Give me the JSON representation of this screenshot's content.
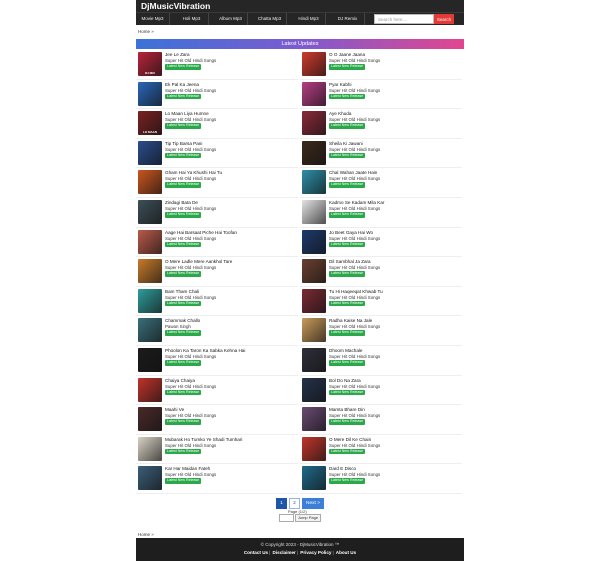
{
  "site": {
    "title": "DjMusicVibration"
  },
  "nav": {
    "items": [
      "Movie Mp3",
      "Holi Mp3",
      "Album Mp3",
      "Chatta Mp3",
      "Hindi Mp3",
      "DJ Remix"
    ],
    "search_placeholder": "Search here....",
    "search_button": "Search"
  },
  "breadcrumb": "Home »",
  "breadcrumb_bottom": "Home »",
  "section_title": "Latest Updates",
  "items": [
    {
      "title": "Jee Le Zara",
      "artist": "Super Hit Old Hindi Songs",
      "badge": "Latest New Release",
      "color": "#b8243a",
      "thumb_text": "DJ MIX"
    },
    {
      "title": "O O Jaane Jaana",
      "artist": "Super Hit Old Hindi Songs",
      "badge": "Latest New Release",
      "color": "#cf3a2e",
      "thumb_text": ""
    },
    {
      "title": "Ek Pal Ka Jeena",
      "artist": "Super Hit Old Hindi Songs",
      "badge": "Latest New Release",
      "color": "#2a67b8",
      "thumb_text": ""
    },
    {
      "title": "Pyar Kabhi",
      "artist": "Super Hit Old Hindi Songs",
      "badge": "Latest New Release",
      "color": "#b63e86",
      "thumb_text": ""
    },
    {
      "title": "Lo Maan Liya Humne",
      "artist": "Super Hit Old Hindi Songs",
      "badge": "Latest New Release",
      "color": "#7a2222",
      "thumb_text": "LO MAAN"
    },
    {
      "title": "Aye Khuda",
      "artist": "Super Hit Old Hindi Songs",
      "badge": "Latest New Release",
      "color": "#8a2a3a",
      "thumb_text": ""
    },
    {
      "title": "Tip Tip Barsa Pani",
      "artist": "Super Hit Old Hindi Songs",
      "badge": "Latest New Release",
      "color": "#2b4d8f",
      "thumb_text": ""
    },
    {
      "title": "Sheila Ki Jawani",
      "artist": "Super Hit Old Hindi Songs",
      "badge": "Latest New Release",
      "color": "#3b2a1c",
      "thumb_text": ""
    },
    {
      "title": "Gham Hai Ya Khushi Hai Tu",
      "artist": "Super Hit Old Hindi Songs",
      "badge": "Latest New Release",
      "color": "#c9561e",
      "thumb_text": ""
    },
    {
      "title": "Chal Wahan Jaate Hain",
      "artist": "Super Hit Old Hindi Songs",
      "badge": "Latest New Release",
      "color": "#2d8fa8",
      "thumb_text": ""
    },
    {
      "title": "Zindagi Bata De",
      "artist": "Super Hit Old Hindi Songs",
      "badge": "Latest New Release",
      "color": "#3d4f57",
      "thumb_text": ""
    },
    {
      "title": "Kadmo Se Kadam Mila Kar",
      "artist": "Super Hit Old Hindi Songs",
      "badge": "Latest New Release",
      "color": "#e3e3e3",
      "thumb_text": ""
    },
    {
      "title": "Aage Hai Barsaat Piche Hai Toofan",
      "artist": "Super Hit Old Hindi Songs",
      "badge": "Latest New Release",
      "color": "#b95a4a",
      "thumb_text": ""
    },
    {
      "title": "Jo Beet Gaya Hai Wo",
      "artist": "Super Hit Old Hindi Songs",
      "badge": "Latest New Release",
      "color": "#1d3a6b",
      "thumb_text": ""
    },
    {
      "title": "O Mere Ladle Mere Aankhol Tare",
      "artist": "Super Hit Old Hindi Songs",
      "badge": "Latest New Release",
      "color": "#c77b2a",
      "thumb_text": ""
    },
    {
      "title": "Dil Sambhal Ja Zara",
      "artist": "Super Hit Old Hindi Songs",
      "badge": "Latest New Release",
      "color": "#6b4030",
      "thumb_text": ""
    },
    {
      "title": "Bam Tham Chali",
      "artist": "Super Hit Old Hindi Songs",
      "badge": "Latest New Release",
      "color": "#2e9c9a",
      "thumb_text": ""
    },
    {
      "title": "Tu Hi Haqeeqat Khwab Tu",
      "artist": "Super Hit Old Hindi Songs",
      "badge": "Latest New Release",
      "color": "#7b2a33",
      "thumb_text": ""
    },
    {
      "title": "Chammak Challo",
      "artist": "Pawan Singh",
      "badge": "Latest New Release",
      "color": "#3a6f7a",
      "thumb_text": ""
    },
    {
      "title": "Radha Kaise Na Jale",
      "artist": "Super Hit Old Hindi Songs",
      "badge": "Latest New Release",
      "color": "#c99b5a",
      "thumb_text": ""
    },
    {
      "title": "Phoolon Ka Taron Ka Sabka Kehna Hai",
      "artist": "Super Hit Old Hindi Songs",
      "badge": "Latest New Release",
      "color": "#1b1b1b",
      "thumb_text": ""
    },
    {
      "title": "Dhoom Machale",
      "artist": "Super Hit Old Hindi Songs",
      "badge": "Latest New Release",
      "color": "#2f2f3a",
      "thumb_text": ""
    },
    {
      "title": "Chaiya Chaiya",
      "artist": "Super Hit Old Hindi Songs",
      "badge": "Latest New Release",
      "color": "#c0332b",
      "thumb_text": ""
    },
    {
      "title": "Bol Do Na Zara",
      "artist": "Super Hit Old Hindi Songs",
      "badge": "Latest New Release",
      "color": "#25324a",
      "thumb_text": ""
    },
    {
      "title": "Maahi Ve",
      "artist": "Super Hit Old Hindi Songs",
      "badge": "Latest New Release",
      "color": "#4a2a2a",
      "thumb_text": ""
    },
    {
      "title": "Mamta Bhare Din",
      "artist": "Super Hit Old Hindi Songs",
      "badge": "Latest New Release",
      "color": "#6a4b73",
      "thumb_text": ""
    },
    {
      "title": "Mubarak Ho Tumko Ye Shadi Tumhari",
      "artist": "Super Hit Old Hindi Songs",
      "badge": "Latest New Release",
      "color": "#d9d2c4",
      "thumb_text": ""
    },
    {
      "title": "O Mere Dil Ke Chain",
      "artist": "Super Hit Old Hindi Songs",
      "badge": "Latest New Release",
      "color": "#c0362c",
      "thumb_text": ""
    },
    {
      "title": "Kar Har Maidan Fateh",
      "artist": "Super Hit Old Hindi Songs",
      "badge": "Latest New Release",
      "color": "#3b5e78",
      "thumb_text": ""
    },
    {
      "title": "Dard E Disco",
      "artist": "Super Hit Old Hindi Songs",
      "badge": "Latest New Release",
      "color": "#1f6a8a",
      "thumb_text": ""
    }
  ],
  "pagination": {
    "pages": [
      "1",
      "2"
    ],
    "next": "Next >",
    "info": "Page (1/2)",
    "jump_button": "Jump Page"
  },
  "footer": {
    "copyright": "© Copyright 2023 - DjMusicVibration ™",
    "links": [
      "Contact Us",
      "Disclaimer",
      "Privacy Policy",
      "About Us"
    ]
  }
}
